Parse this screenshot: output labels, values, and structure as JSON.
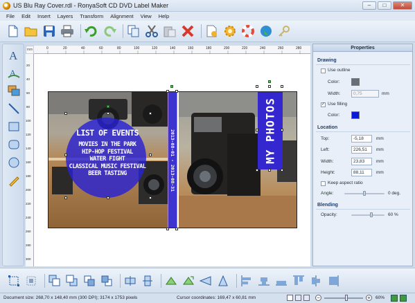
{
  "window": {
    "title": "US Blu Ray Cover.rdl - RonyaSoft CD DVD Label Maker",
    "buttons": [
      "–",
      "□",
      "✕"
    ]
  },
  "menu": [
    "File",
    "Edit",
    "Insert",
    "Layers",
    "Transform",
    "Alignment",
    "View",
    "Help"
  ],
  "toolbar": [
    "new-icon",
    "open-icon",
    "save-icon",
    "print-icon",
    "undo-icon",
    "redo-icon",
    "copy-icon",
    "cut-icon",
    "paste-icon",
    "delete-icon",
    "properties-icon",
    "settings-icon",
    "help-icon",
    "web-icon",
    "key-icon"
  ],
  "tools": [
    "text-tool-icon",
    "curved-text-tool-icon",
    "image-tool-icon",
    "line-tool-icon",
    "rectangle-tool-icon",
    "rounded-rectangle-tool-icon",
    "ellipse-tool-icon",
    "pencil-tool-icon"
  ],
  "ruler": {
    "unit": "mm",
    "h": [
      "0",
      "20",
      "40",
      "60",
      "80",
      "100",
      "120",
      "140",
      "160",
      "180",
      "200",
      "220",
      "240",
      "260",
      "280"
    ],
    "v": [
      "20",
      "40",
      "60",
      "80",
      "100",
      "120",
      "140",
      "160",
      "180",
      "200",
      "220",
      "240",
      "260",
      "280",
      "300"
    ]
  },
  "label": {
    "events_title": "LIST OF EVENTS",
    "events": [
      "MOVIES IN THE PARK",
      "HIP-HOP FESTIVAL",
      "WATER FIGHT",
      "CLASSICAL MUSIC FESTIVAL",
      "BEER TASTING"
    ],
    "spine_text": "2013-08-01 - 2013-08-31",
    "cover_title": "MY PHOTOS"
  },
  "properties": {
    "title": "Properties",
    "drawing": {
      "title": "Drawing",
      "use_outline": "Use outline",
      "use_outline_checked": false,
      "color_label": "Color:",
      "outline_color": "#6a6f77",
      "width_label": "Width:",
      "width_value": "0,75",
      "width_unit": "mm",
      "use_filling": "Use filling",
      "use_filling_checked": true,
      "fill_color_label": "Color:",
      "fill_color": "#0a18d8"
    },
    "location": {
      "title": "Location",
      "top_label": "Top:",
      "top": "-5,18",
      "left_label": "Left:",
      "left": "226,51",
      "width_label": "Width:",
      "width": "23,83",
      "height_label": "Height:",
      "height": "88,11",
      "unit": "mm",
      "keep_aspect": "Keep aspect ratio",
      "keep_aspect_checked": false,
      "angle_label": "Angle:",
      "angle": "0 deg."
    },
    "blending": {
      "title": "Blending",
      "opacity_label": "Opacity:",
      "opacity": "60 %",
      "opacity_value": 0.6
    }
  },
  "bottom_tools": [
    "fit-page-icon",
    "fit-selection-icon",
    "bring-front-icon",
    "send-back-icon",
    "bring-forward-icon",
    "send-backward-icon",
    "flip-horizontal-icon",
    "flip-vertical-icon",
    "rotate-left-icon",
    "rotate-right-icon",
    "skew-left-icon",
    "skew-right-icon",
    "align-left-icon",
    "align-center-icon",
    "align-right-icon",
    "align-top-icon",
    "align-middle-icon",
    "align-bottom-icon"
  ],
  "status": {
    "doc_size": "Document size: 268,70 x 148,40 mm (300 DPI); 3174 x 1753 pixels",
    "cursor": "Cursor coordinates: 169,47 x 60,81 mm",
    "zoom": "60%",
    "zoom_value": 0.6
  }
}
